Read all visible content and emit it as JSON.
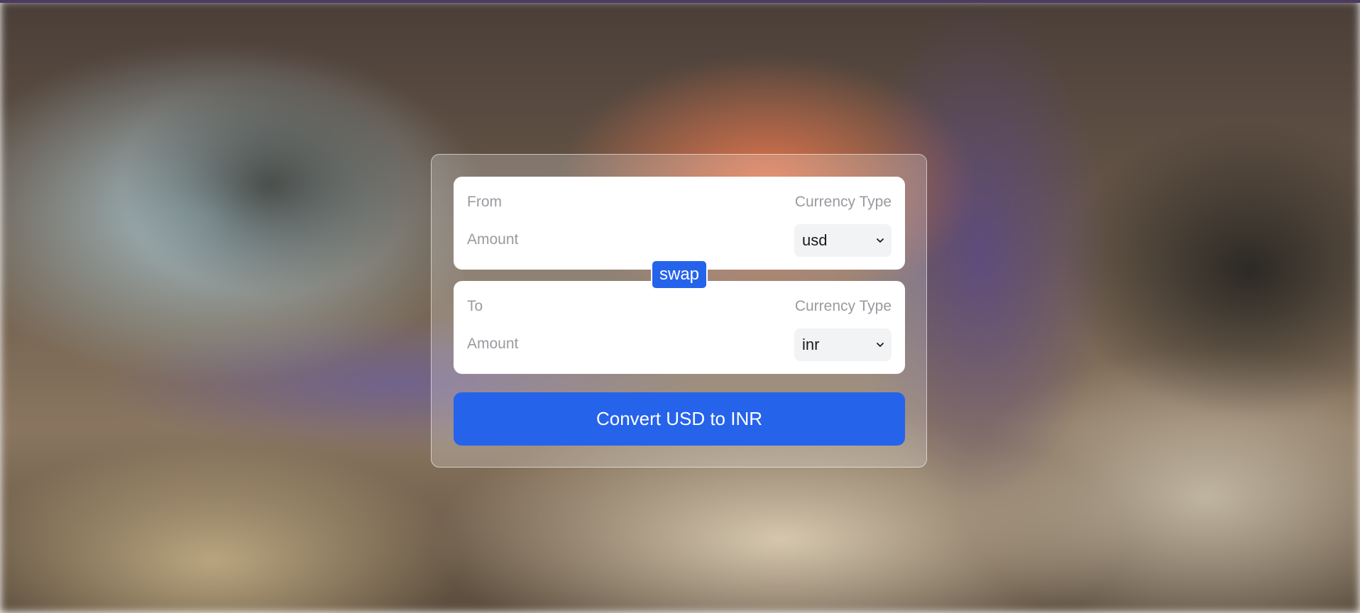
{
  "from": {
    "label": "From",
    "amount_placeholder": "Amount",
    "amount_value": "",
    "currency_label": "Currency Type",
    "currency_selected": "usd"
  },
  "swap_label": "swap",
  "to": {
    "label": "To",
    "amount_placeholder": "Amount",
    "amount_value": "",
    "currency_label": "Currency Type",
    "currency_selected": "inr"
  },
  "convert_label": "Convert USD to INR",
  "colors": {
    "accent": "#2563eb",
    "card": "#ffffff",
    "select_bg": "#f2f3f5",
    "muted_text": "#9a9aa0"
  },
  "icons": {
    "select_arrow": "chevron-down-icon"
  }
}
